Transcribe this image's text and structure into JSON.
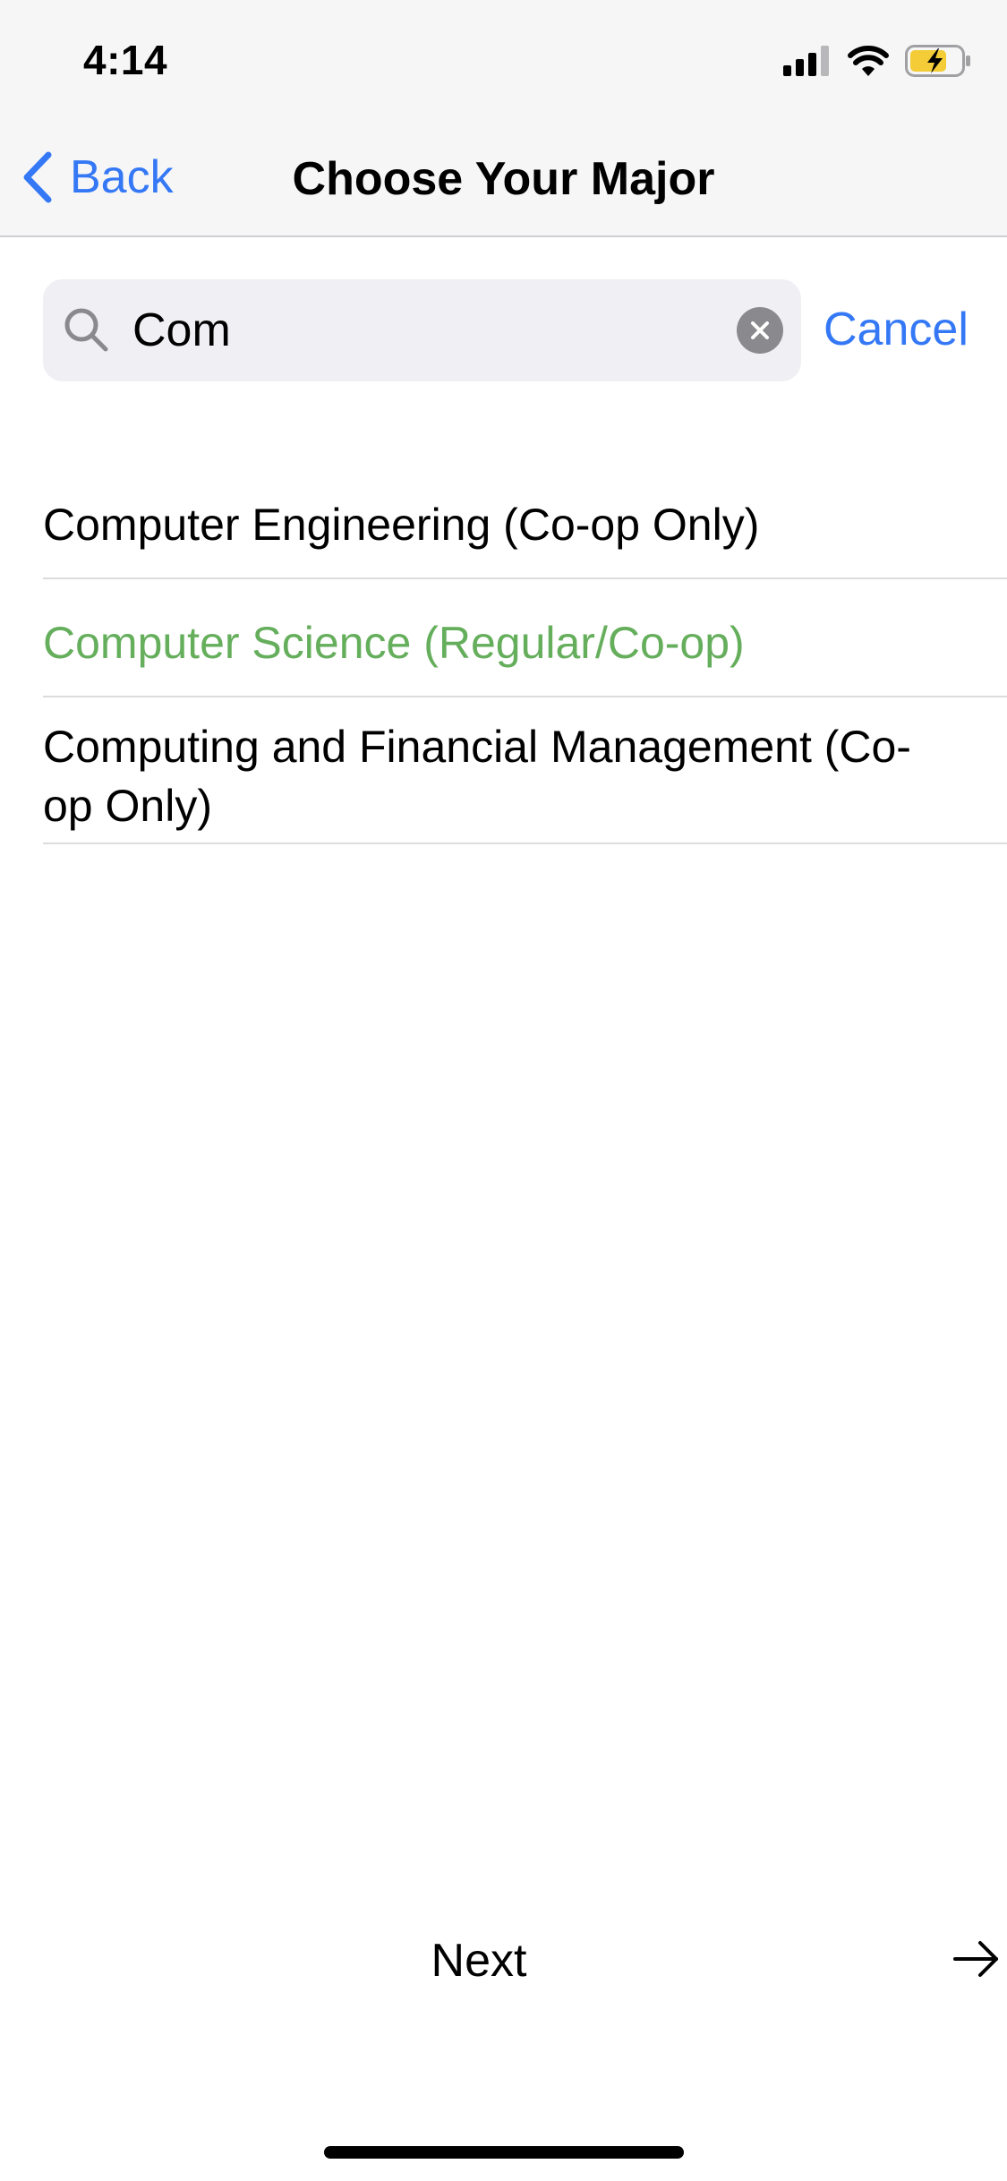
{
  "status_bar": {
    "time": "4:14",
    "icons": [
      "cellular-signal-icon",
      "wifi-icon",
      "battery-charging-icon"
    ]
  },
  "nav": {
    "back_label": "Back",
    "title": "Choose Your Major"
  },
  "search": {
    "value": "Com",
    "cancel_label": "Cancel"
  },
  "results": [
    {
      "label": "Computer Engineering (Co-op Only)",
      "selected": false
    },
    {
      "label": "Computer Science (Regular/Co-op)",
      "selected": true
    },
    {
      "label": "Computing and Financial Management (Co-op Only)",
      "selected": false
    }
  ],
  "footer": {
    "next_label": "Next"
  },
  "colors": {
    "accent": "#3478f6",
    "selected": "#65ae5c",
    "battery_fill": "#f3cc38"
  }
}
